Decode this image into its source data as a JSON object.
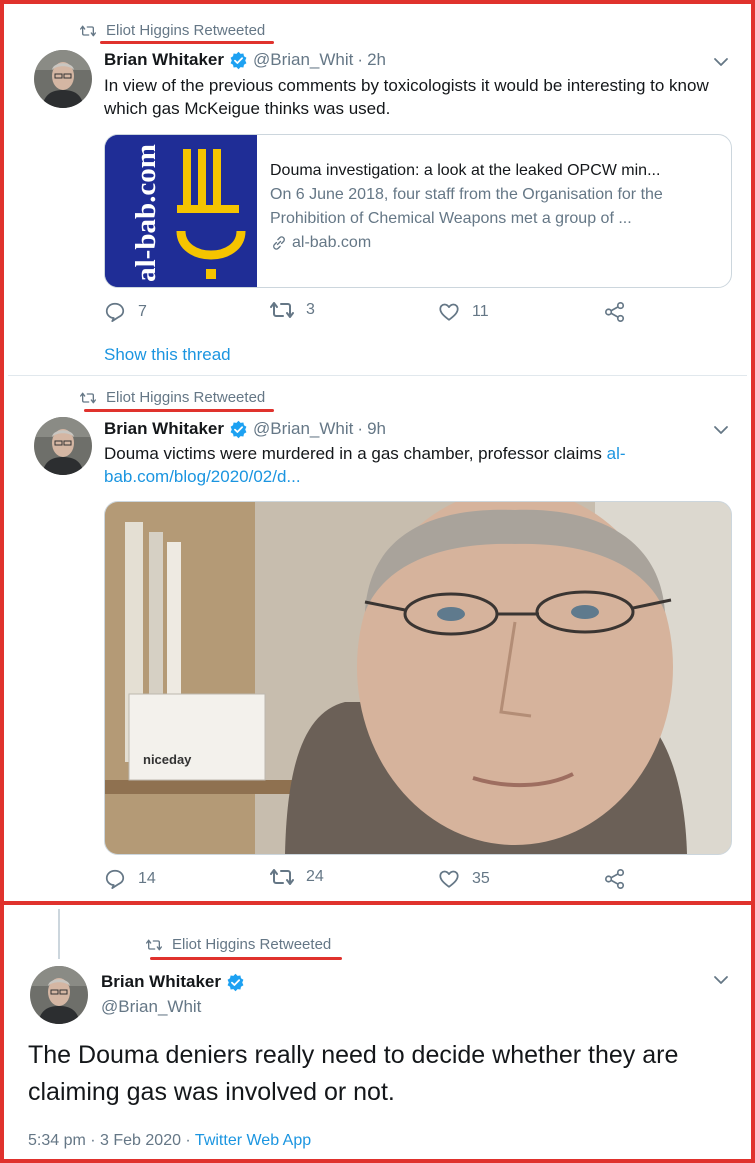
{
  "colors": {
    "accent": "#1b95e0",
    "highlight": "#e0322d",
    "muted": "#657786",
    "verified": "#1da1f2"
  },
  "tweets": [
    {
      "retweet_label": "Eliot Higgins Retweeted",
      "author_name": "Brian Whitaker",
      "handle": "@Brian_Whit",
      "dot": "·",
      "time": "2h",
      "text": "In view of the previous comments by toxicologists it would be interesting to know which gas McKeigue thinks was used.",
      "card": {
        "image_text": "al-bab.com",
        "title": "Douma investigation: a look at the leaked OPCW min...",
        "description": "On 6 June 2018, four staff from the Organisation for the Prohibition of Chemical Weapons met a group of ...",
        "domain": "al-bab.com"
      },
      "replies": "7",
      "retweets": "3",
      "likes": "11",
      "show_thread": "Show this thread"
    },
    {
      "retweet_label": "Eliot Higgins Retweeted",
      "author_name": "Brian Whitaker",
      "handle": "@Brian_Whit",
      "dot": "·",
      "time": "9h",
      "text_plain": "Douma victims were murdered in a gas chamber, professor claims ",
      "text_link": "al-bab.com/blog/2020/02/d...",
      "photo_label": "niceday",
      "replies": "14",
      "retweets": "24",
      "likes": "35"
    },
    {
      "retweet_label": "Eliot Higgins Retweeted",
      "author_name": "Brian Whitaker",
      "handle": "@Brian_Whit",
      "text": "The Douma deniers really need to decide whether they are claiming gas was involved or not.",
      "timestamp": "5:34 pm · 3 Feb 2020 · ",
      "app": "Twitter Web App"
    }
  ]
}
